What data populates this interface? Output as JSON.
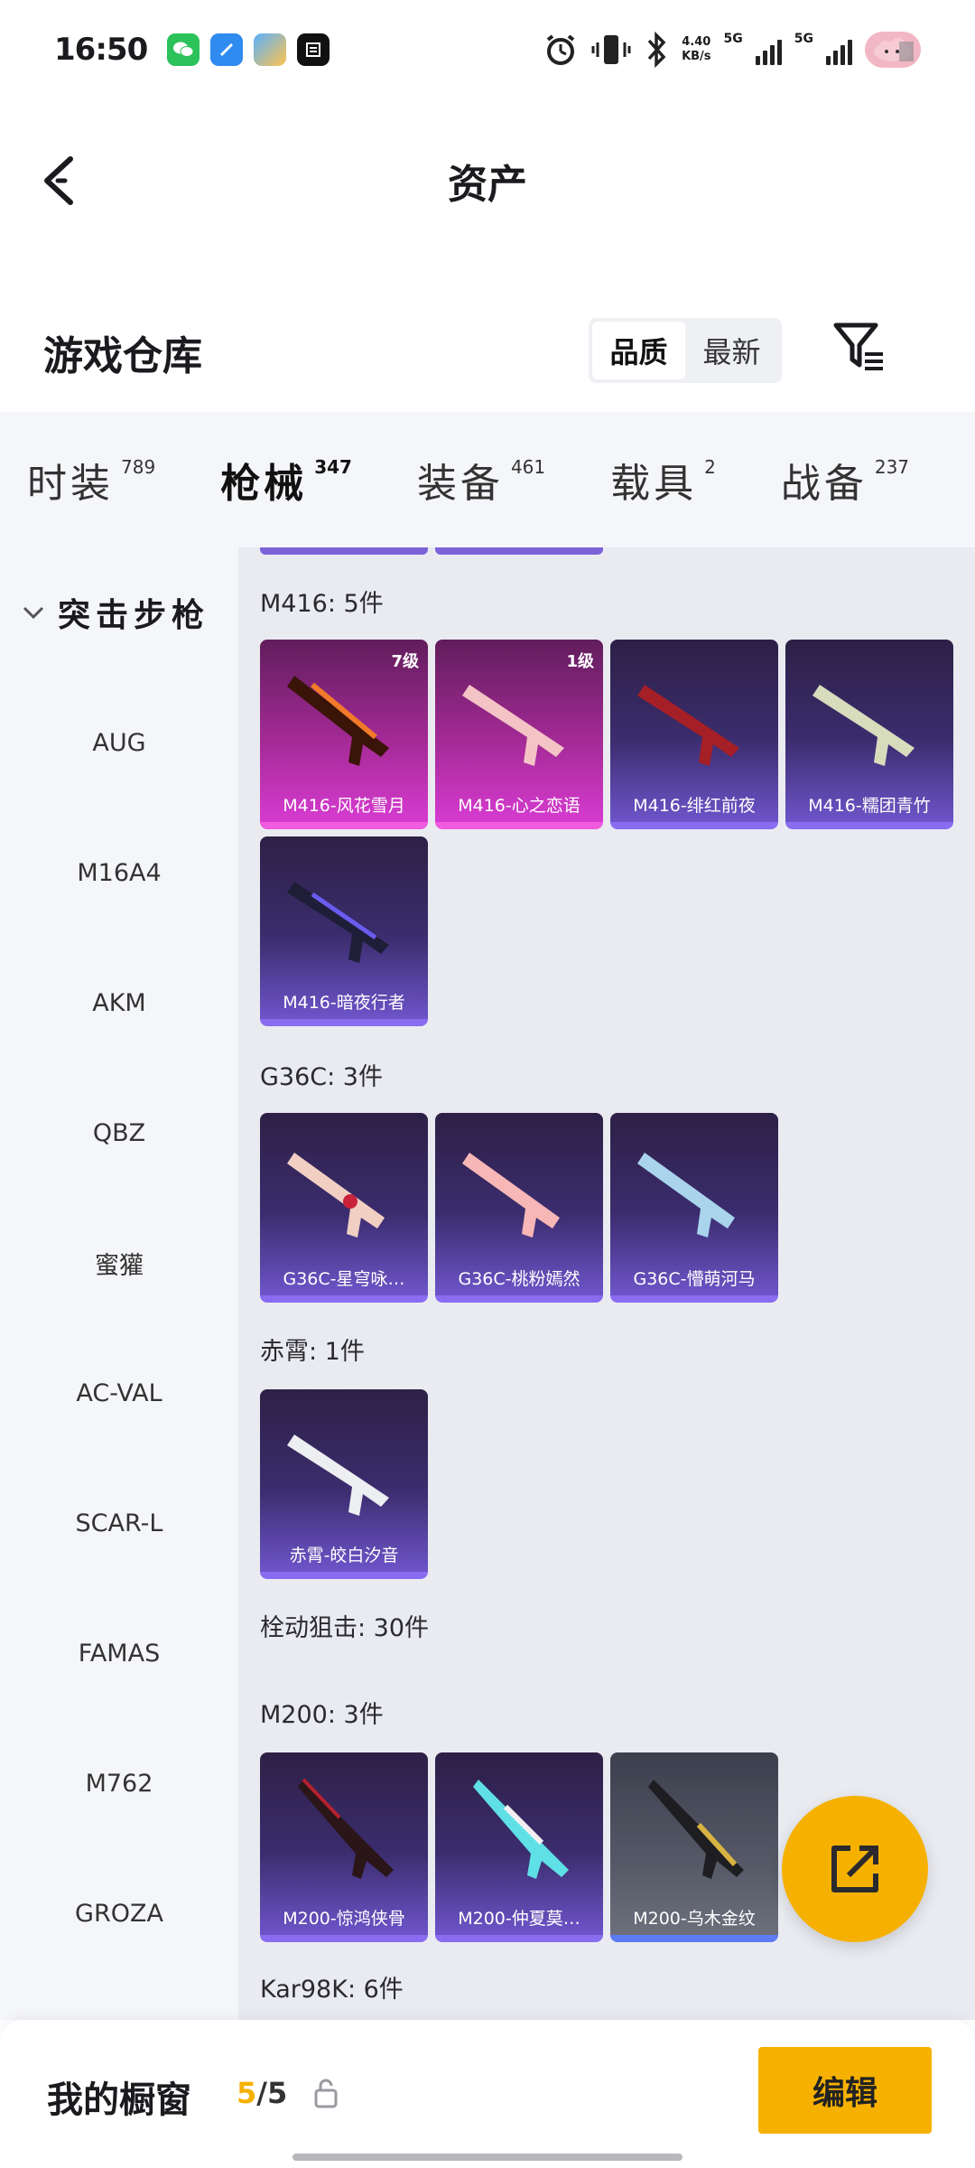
{
  "status_bar": {
    "time": "16:50",
    "app_icons": [
      "wechat-icon",
      "blue-app-icon",
      "gallery-app-icon",
      "news-app-icon"
    ],
    "net_speed_value": "4.40",
    "net_speed_unit": "KB/s",
    "sim1": "5G",
    "sim2": "5G"
  },
  "header": {
    "title": "资产"
  },
  "warehouse": {
    "title": "游戏仓库",
    "sort_options": [
      "品质",
      "最新"
    ],
    "active_sort": 0
  },
  "tabs": [
    {
      "label": "时装",
      "count": "789"
    },
    {
      "label": "枪械",
      "count": "347"
    },
    {
      "label": "装备",
      "count": "461"
    },
    {
      "label": "载具",
      "count": "2"
    },
    {
      "label": "战备",
      "count": "237"
    }
  ],
  "active_tab": 1,
  "sidebar": {
    "group": "突击步枪",
    "items": [
      "AUG",
      "M16A4",
      "AKM",
      "QBZ",
      "蜜獾",
      "AC-VAL",
      "SCAR-L",
      "FAMAS",
      "M762",
      "GROZA"
    ]
  },
  "sections": {
    "m416": {
      "title": "M416: 5件",
      "items": [
        {
          "name": "M416-风花雪月",
          "level": "7级",
          "color": "pink"
        },
        {
          "name": "M416-心之恋语",
          "level": "1级",
          "color": "pink"
        },
        {
          "name": "M416-绯红前夜",
          "color": "purple"
        },
        {
          "name": "M416-糯团青竹",
          "color": "purple"
        },
        {
          "name": "M416-暗夜行者",
          "color": "purple"
        }
      ]
    },
    "g36c": {
      "title": "G36C: 3件",
      "items": [
        {
          "name": "G36C-星穹咏…",
          "color": "purple"
        },
        {
          "name": "G36C-桃粉嫣然",
          "color": "purple"
        },
        {
          "name": "G36C-懵萌河马",
          "color": "purple"
        }
      ]
    },
    "chixiao": {
      "title": "赤霄: 1件",
      "items": [
        {
          "name": "赤霄-皎白汐音",
          "color": "purple"
        }
      ]
    },
    "bolt": {
      "title": "栓动狙击: 30件"
    },
    "m200": {
      "title": "M200: 3件",
      "items": [
        {
          "name": "M200-惊鸿侠骨",
          "color": "purple"
        },
        {
          "name": "M200-仲夏莫…",
          "color": "purple"
        },
        {
          "name": "M200-乌木金纹",
          "color": "gray"
        }
      ]
    },
    "kar98k": {
      "title": "Kar98K: 6件"
    }
  },
  "bottom_bar": {
    "title": "我的橱窗",
    "count_current": "5",
    "count_total": "/5",
    "edit_label": "编辑"
  },
  "colors": {
    "accent": "#f6b100",
    "epic": "#8a6cf0",
    "legendary": "#d63bd0"
  }
}
